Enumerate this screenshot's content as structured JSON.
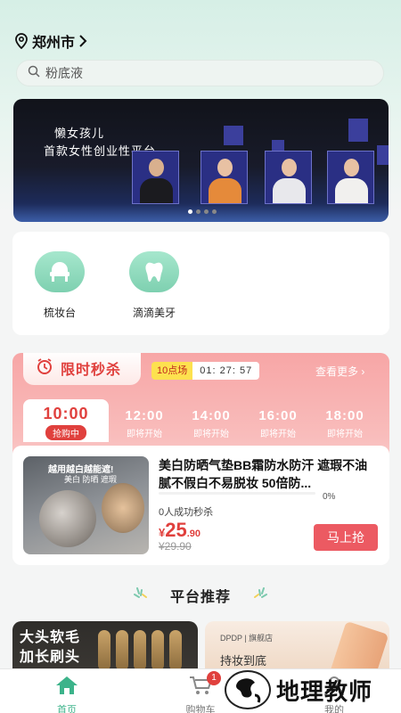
{
  "location": {
    "city": "郑州市"
  },
  "search": {
    "placeholder": "粉底液"
  },
  "banner": {
    "line1": "懒女孩儿",
    "line2": "首款女性创业性平台",
    "slides": 4,
    "active_slide": 0
  },
  "categories": [
    {
      "label": "梳妆台",
      "icon": "vanity-icon"
    },
    {
      "label": "滴滴美牙",
      "icon": "tooth-icon"
    }
  ],
  "flash_sale": {
    "title": "限时秒杀",
    "session": "10点场",
    "countdown": "01: 27: 57",
    "more": "查看更多",
    "slots": [
      {
        "time": "10:00",
        "status": "抢购中"
      },
      {
        "time": "12:00",
        "status": "即将开始"
      },
      {
        "time": "14:00",
        "status": "即将开始"
      },
      {
        "time": "16:00",
        "status": "即将开始"
      },
      {
        "time": "18:00",
        "status": "即将开始"
      }
    ],
    "product": {
      "image_caption": "越用越白越能遮!",
      "image_subcaption": "美白 防晒 遮瑕",
      "title": "美白防晒气垫BB霜防水防汗 遮瑕不油腻不假白不易脱妆 50倍防...",
      "progress_percent": "0%",
      "sold": "0人成功秒杀",
      "currency": "¥",
      "price_int": "25",
      "price_dec": ".90",
      "old_price": "¥29.90",
      "buy_label": "马上抢"
    }
  },
  "recommend": {
    "title": "平台推荐",
    "card1": {
      "line1": "大头软毛",
      "line2": "加长刷头"
    },
    "card2": {
      "store": "DPDP | 旗舰店",
      "text": "持妆到底"
    }
  },
  "tabbar": {
    "tabs": [
      {
        "label": "首页",
        "icon": "home-icon",
        "active": true
      },
      {
        "label": "购物车",
        "icon": "cart-icon",
        "badge": "1"
      },
      {
        "label": "我的",
        "icon": "user-icon"
      }
    ]
  },
  "watermark": {
    "text": "地理教师"
  },
  "colors": {
    "accent": "#3cb38a",
    "sale_red": "#e0403d",
    "sale_pink": "#f7a6a6",
    "buy_button": "#ec5a62"
  }
}
